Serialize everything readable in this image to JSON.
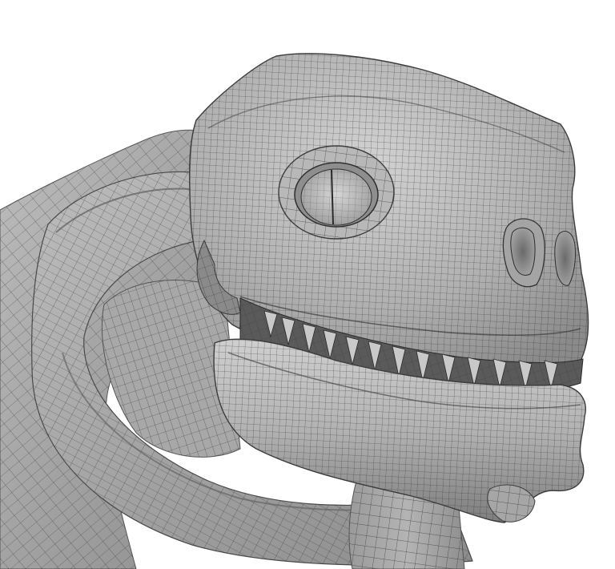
{
  "scene": {
    "subject": "creature-head-wireframe-mesh",
    "background_color": "#ffffff",
    "mesh_base_color": "#a9a9a9",
    "mesh_light_color": "#cfcfcf",
    "mesh_dark_color": "#6f6f6f",
    "wire_color": "#2b2b2b"
  }
}
